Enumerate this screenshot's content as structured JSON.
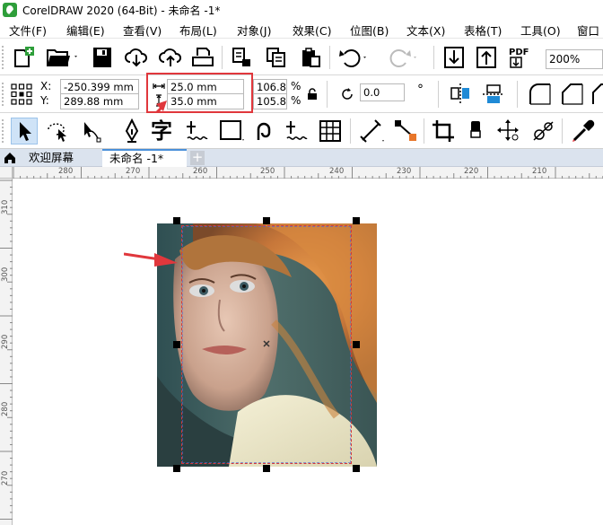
{
  "window": {
    "title": "CorelDRAW 2020 (64-Bit) - 未命名 -1*"
  },
  "menu": [
    "文件(F)",
    "编辑(E)",
    "查看(V)",
    "布局(L)",
    "对象(J)",
    "效果(C)",
    "位图(B)",
    "文本(X)",
    "表格(T)",
    "工具(O)",
    "窗口"
  ],
  "toolbar": {
    "zoom_value": "200%"
  },
  "property_bar": {
    "x_label": "X:",
    "y_label": "Y:",
    "x_value": "-250.399 mm",
    "y_value": "289.88 mm",
    "width_value": "25.0 mm",
    "height_value": "35.0 mm",
    "scale_x": "106.8",
    "scale_y": "105.8",
    "percent_symbol": "%",
    "rotation_value": "0.0",
    "degree_symbol": "°"
  },
  "tabs": [
    {
      "label": "欢迎屏幕"
    },
    {
      "label": "未命名 -1*"
    }
  ],
  "tab_add_label": "+",
  "ruler": {
    "h_ticks": [
      "280",
      "270",
      "260",
      "250",
      "240",
      "230",
      "220",
      "210"
    ],
    "v_ticks": [
      "310",
      "300",
      "290",
      "280",
      "270"
    ]
  },
  "colors": {
    "accent_red": "#e0373c",
    "tab_bar": "#dbe3ee",
    "brand_green": "#2e9e3a"
  },
  "icons": [
    "new-doc-icon",
    "open-folder-icon",
    "save-icon",
    "cloud-download-icon",
    "cloud-upload-icon",
    "print-icon",
    "copy-icon",
    "undo-icon",
    "redo-icon",
    "import-icon",
    "export-icon",
    "pdf-icon",
    "pick-tool-icon",
    "pen-tool-icon",
    "text-tool-icon",
    "rectangle-tool-icon",
    "crop-tool-icon",
    "eyedropper-icon"
  ]
}
